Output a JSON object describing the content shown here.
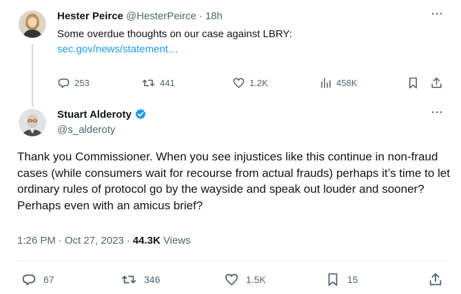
{
  "reply_parent": {
    "display_name": "Hester Peirce",
    "handle": "@HesterPeirce",
    "separator": "·",
    "time_ago": "18h",
    "text": "Some overdue thoughts on our case against LBRY:",
    "link_text": "sec.gov/news/statement…",
    "actions": {
      "replies": "253",
      "reposts": "441",
      "likes": "1.2K",
      "views": "458K"
    }
  },
  "main_tweet": {
    "display_name": "Stuart Alderoty",
    "handle": "@s_alderoty",
    "text": "Thank you Commissioner. When you see injustices like this continue in non-fraud cases (while consumers wait for recourse from actual frauds) perhaps it’s time to let ordinary rules of protocol go by the wayside and speak out louder and sooner? Perhaps even with an amicus brief?",
    "time": "1:26 PM",
    "date": "Oct 27, 2023",
    "views_count": "44.3K",
    "views_label": "Views",
    "separator": "·",
    "actions": {
      "replies": "67",
      "reposts": "346",
      "likes": "1.5K",
      "bookmarks": "15"
    }
  },
  "more_glyph": "···",
  "colors": {
    "verified": "#1d9bf0",
    "link": "#1d9bf0",
    "muted": "#536471",
    "text": "#0f1419"
  }
}
